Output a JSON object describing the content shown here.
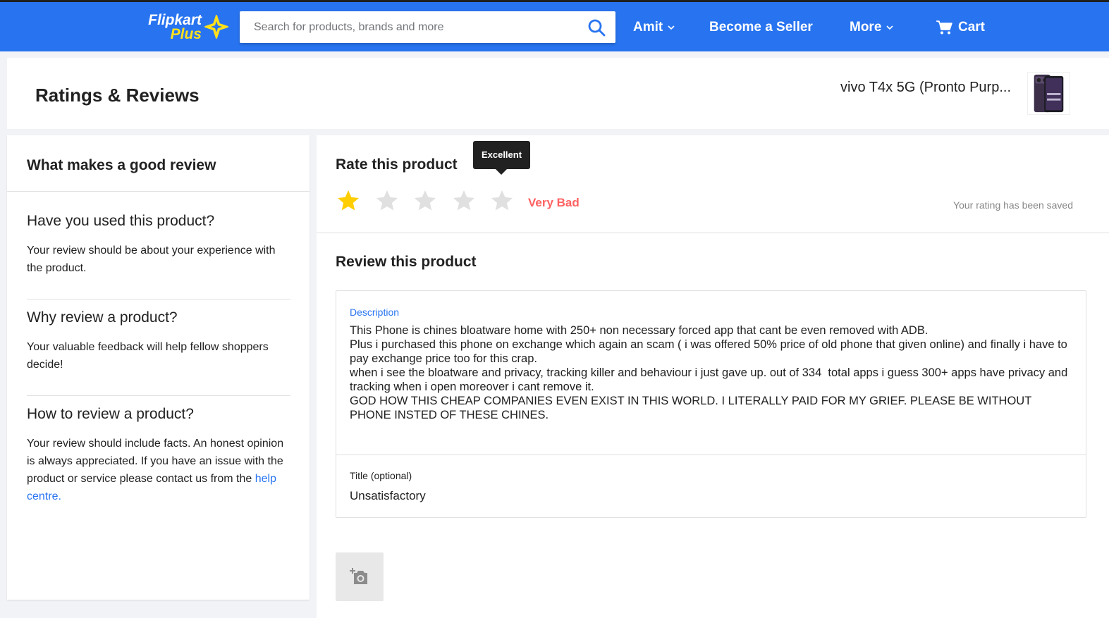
{
  "header": {
    "logo_text": "Flipkart",
    "logo_plus": "Plus",
    "search": {
      "placeholder": "Search for products, brands and more",
      "value": ""
    },
    "nav": {
      "account": "Amit",
      "seller": "Become a Seller",
      "more": "More",
      "cart": "Cart"
    },
    "colors": {
      "bar": "#2874f0",
      "logo_accent": "#ffe11b"
    }
  },
  "title_bar": {
    "title": "Ratings & Reviews",
    "product_name": "vivo T4x 5G (Pronto Purp..."
  },
  "guide": {
    "heading": "What makes a good review",
    "tips": [
      {
        "title": "Have you used this product?",
        "body": "Your review should be about your experience with the product."
      },
      {
        "title": "Why review a product?",
        "body": "Your valuable feedback will help fellow shoppers decide!"
      },
      {
        "title": "How to review a product?",
        "body": "Your review should include facts. An honest opinion is always appreciated. If you have an issue with the product or service please contact us from the ",
        "link": "help centre."
      }
    ]
  },
  "rating": {
    "heading": "Rate this product",
    "tooltip": "Excellent",
    "value": 1,
    "max": 5,
    "label": "Very Bad",
    "saved_text": "Your rating has been saved",
    "colors": {
      "filled": "#ffce00",
      "empty": "#e0e0e0",
      "label": "#ff6161"
    }
  },
  "review": {
    "heading": "Review this product",
    "description_label": "Description",
    "description_text": "This Phone is chines bloatware home with 250+ non necessary forced app that cant be even removed with ADB.\nPlus i purchased this phone on exchange which again an scam ( i was offered 50% price of old phone that given online) and finally i have to pay exchange price too for this crap.\nwhen i see the bloatware and privacy, tracking killer and behaviour i just gave up. out of 334  total apps i guess 300+ apps have privacy and tracking when i open moreover i cant remove it.\nGOD HOW THIS CHEAP COMPANIES EVEN EXIST IN THIS WORLD. I LITERALLY PAID FOR MY GRIEF. PLEASE BE WITHOUT PHONE INSTED OF THESE CHINES.",
    "title_label": "Title (optional)",
    "title_value": "Unsatisfactory"
  }
}
